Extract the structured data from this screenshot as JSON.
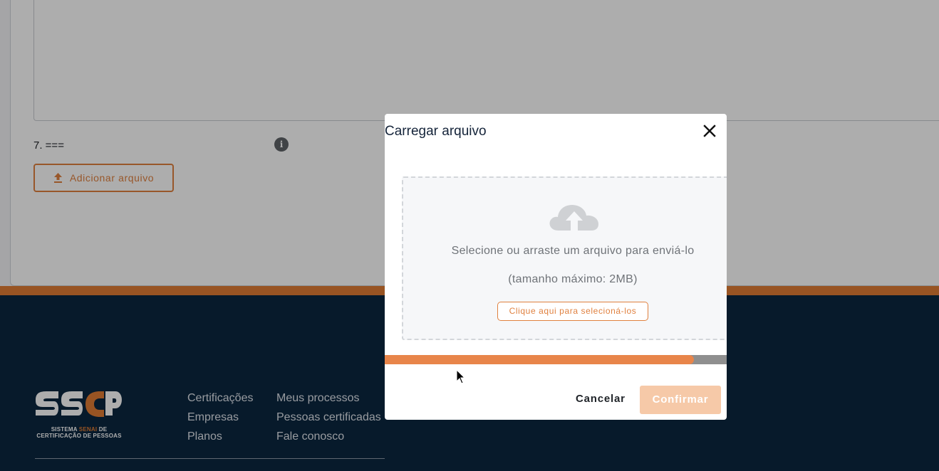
{
  "page": {
    "question_label": "7. ===",
    "info_icon_glyph": "i",
    "add_file_label": "Adicionar arquivo",
    "add_file_icon": "upload-icon"
  },
  "footer": {
    "logo_wordmark": "SSCP",
    "logo_tagline_part1": "SISTEMA ",
    "logo_tagline_highlight": "SENAI",
    "logo_tagline_part2": " DE",
    "logo_tagline_line2": "CERTIFICAÇÃO DE PESSOAS",
    "links_col1": [
      "Certificações",
      "Empresas",
      "Planos"
    ],
    "links_col2": [
      "Meus processos",
      "Pessoas certificadas",
      "Fale conosco"
    ]
  },
  "modal": {
    "title": "Carregar arquivo",
    "close_icon": "close-icon",
    "dropzone": {
      "icon": "cloud-upload-icon",
      "instruction": "Selecione ou arraste um arquivo para enviá-lo",
      "size_limit": "(tamanho máximo: 2MB)",
      "select_button": "Clique aqui para selecioná-los"
    },
    "progress_fraction": 0.905,
    "cancel_label": "Cancelar",
    "confirm_label": "Confirmar"
  },
  "colors": {
    "accent": "#e0813f",
    "footer_bg": "#0b2740",
    "progress_fill": "#e8854a",
    "confirm_disabled": "#f6c9a8"
  }
}
